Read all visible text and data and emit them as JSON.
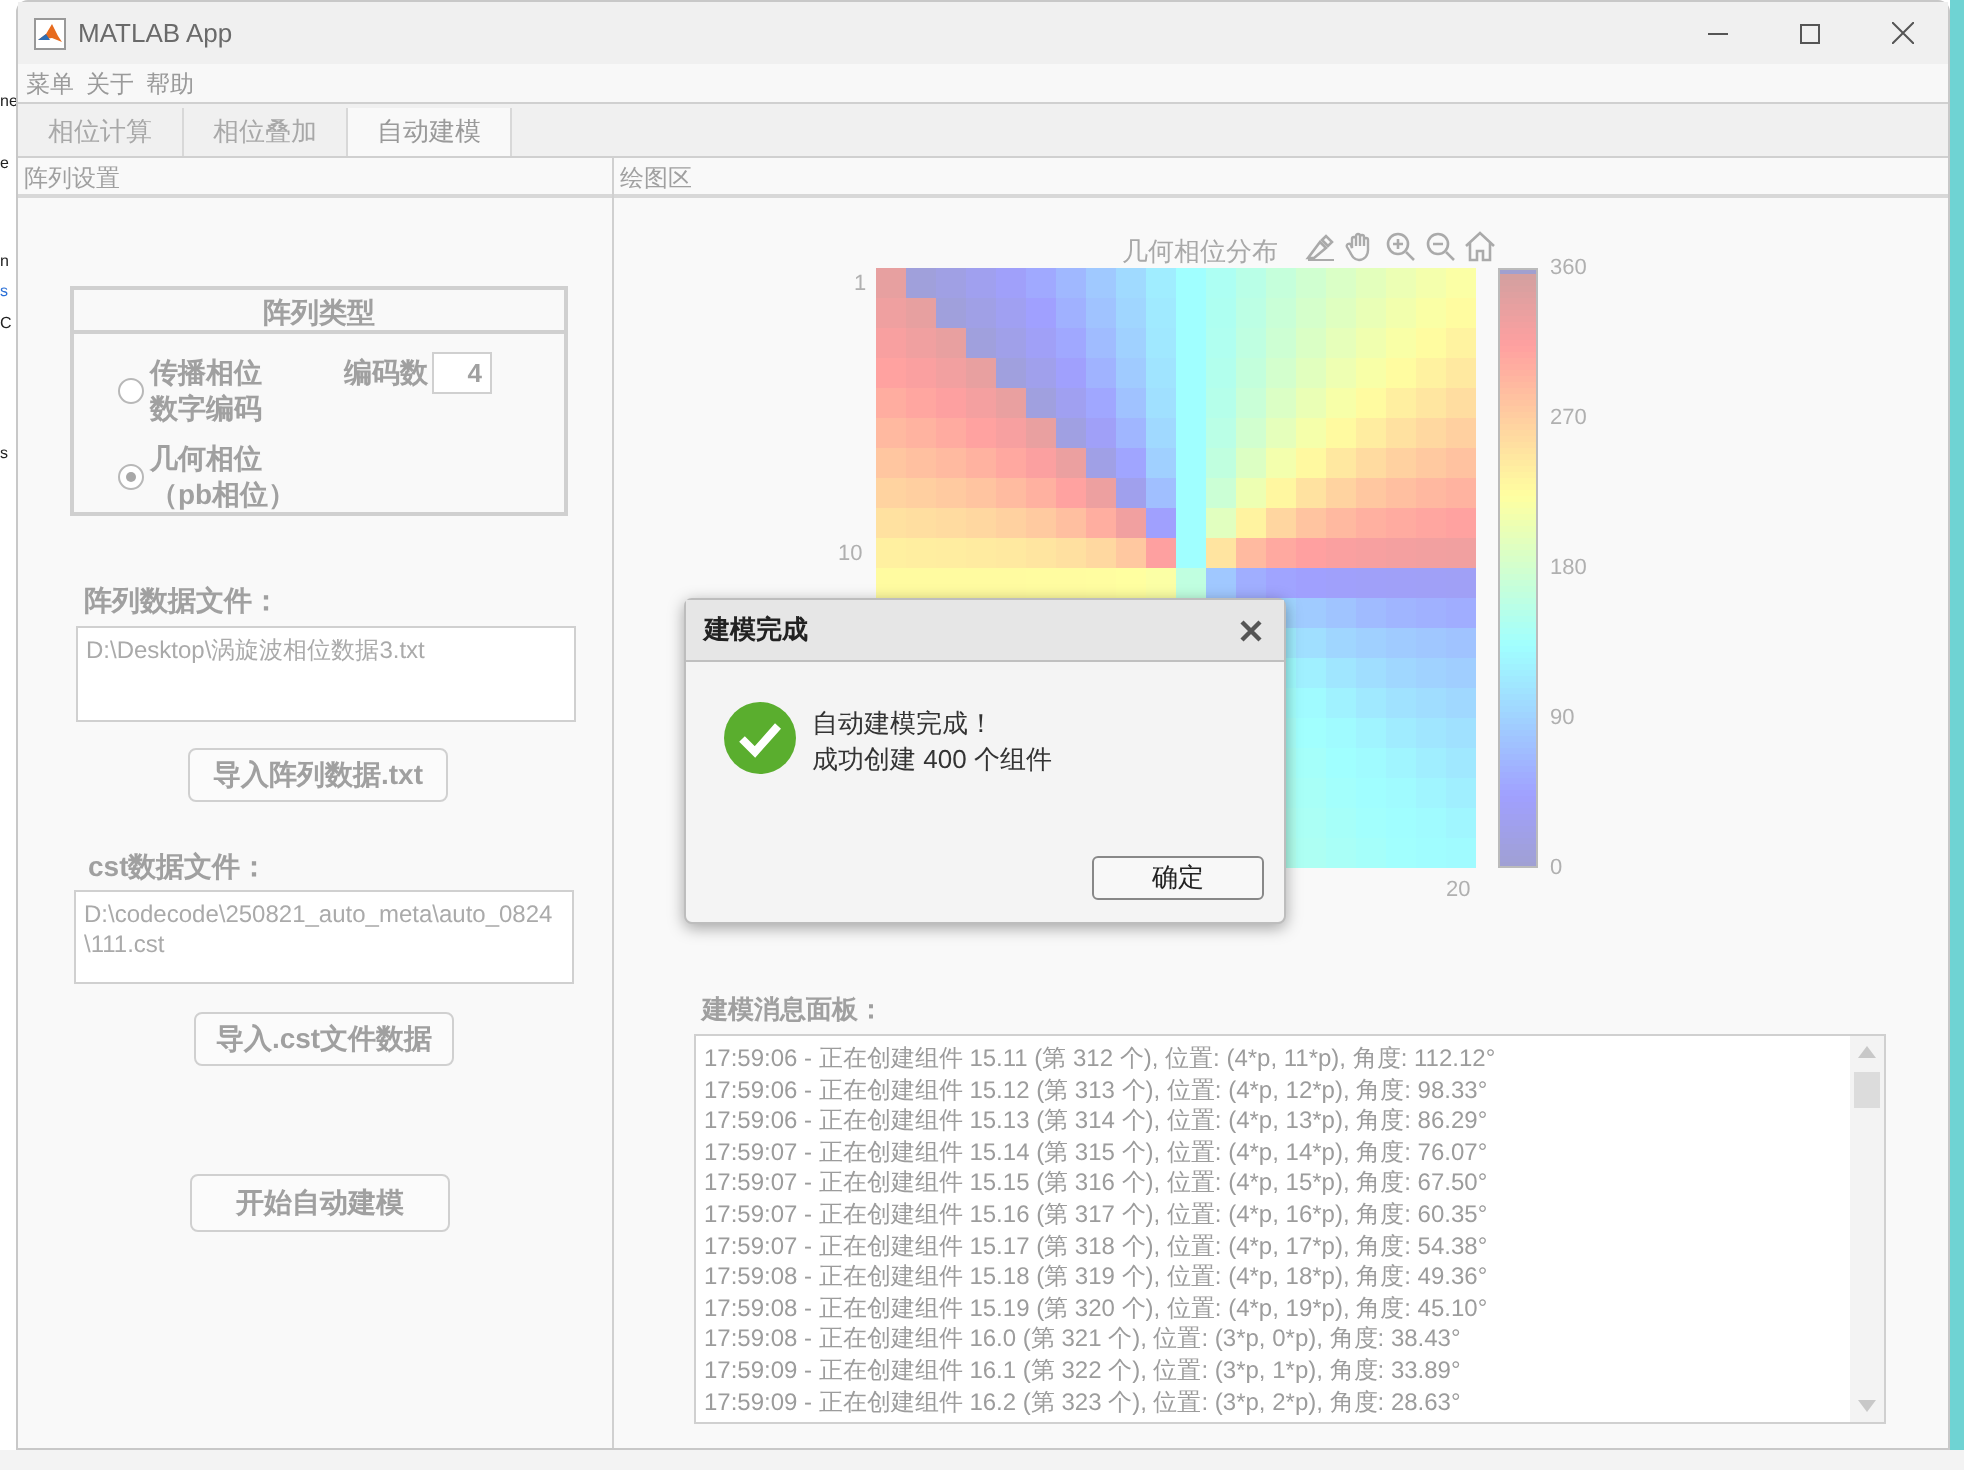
{
  "background": {
    "fragments": [
      "ne",
      "e",
      "n",
      "s",
      "C",
      "s"
    ]
  },
  "window": {
    "title": "MATLAB App"
  },
  "menu": [
    "菜单",
    "关于",
    "帮助"
  ],
  "tabs": [
    {
      "label": "相位计算",
      "selected": false
    },
    {
      "label": "相位叠加",
      "selected": false
    },
    {
      "label": "自动建模",
      "selected": true
    }
  ],
  "left_panel": {
    "title": "阵列设置",
    "array_type": {
      "title": "阵列类型",
      "options": [
        {
          "lines": [
            "传播相位",
            "数字编码"
          ],
          "selected": false
        },
        {
          "lines": [
            "几何相位",
            "（pb相位）"
          ],
          "selected": true
        }
      ],
      "code_count": {
        "label": "编码数",
        "value": "4"
      }
    },
    "array_file": {
      "label": "阵列数据文件：",
      "value": "D:\\Desktop\\涡旋波相位数据3.txt",
      "button": "导入阵列数据.txt"
    },
    "cst_file": {
      "label": "cst数据文件：",
      "value": "D:\\codecode\\250821_auto_meta\\auto_0824\\111.cst",
      "button": "导入.cst文件数据"
    },
    "start_button": "开始自动建模"
  },
  "plot_panel": {
    "title": "绘图区",
    "plot_title": "几何相位分布",
    "y_ticks": [
      "1",
      "10"
    ],
    "x_ticks": [
      "20"
    ],
    "colorbar_ticks": [
      "360",
      "270",
      "180",
      "90",
      "0"
    ]
  },
  "log": {
    "label": "建模消息面板：",
    "lines": [
      "17:59:06 - 正在创建组件 15.11 (第 312 个), 位置: (4*p, 11*p), 角度: 112.12°",
      "17:59:06 - 正在创建组件 15.12 (第 313 个), 位置: (4*p, 12*p), 角度: 98.33°",
      "17:59:06 - 正在创建组件 15.13 (第 314 个), 位置: (4*p, 13*p), 角度: 86.29°",
      "17:59:07 - 正在创建组件 15.14 (第 315 个), 位置: (4*p, 14*p), 角度: 76.07°",
      "17:59:07 - 正在创建组件 15.15 (第 316 个), 位置: (4*p, 15*p), 角度: 67.50°",
      "17:59:07 - 正在创建组件 15.16 (第 317 个), 位置: (4*p, 16*p), 角度: 60.35°",
      "17:59:07 - 正在创建组件 15.17 (第 318 个), 位置: (4*p, 17*p), 角度: 54.38°",
      "17:59:08 - 正在创建组件 15.18 (第 319 个), 位置: (4*p, 18*p), 角度: 49.36°",
      "17:59:08 - 正在创建组件 15.19 (第 320 个), 位置: (4*p, 19*p), 角度: 45.10°",
      "17:59:08 - 正在创建组件 16.0 (第 321 个), 位置: (3*p, 0*p), 角度: 38.43°",
      "17:59:09 - 正在创建组件 16.1 (第 322 个), 位置: (3*p, 1*p), 角度: 33.89°",
      "17:59:09 - 正在创建组件 16.2 (第 323 个), 位置: (3*p, 2*p), 角度: 28.63°"
    ]
  },
  "dialog": {
    "title": "建模完成",
    "message": [
      "自动建模完成！",
      "成功创建 400 个组件"
    ],
    "button": "确定"
  }
}
